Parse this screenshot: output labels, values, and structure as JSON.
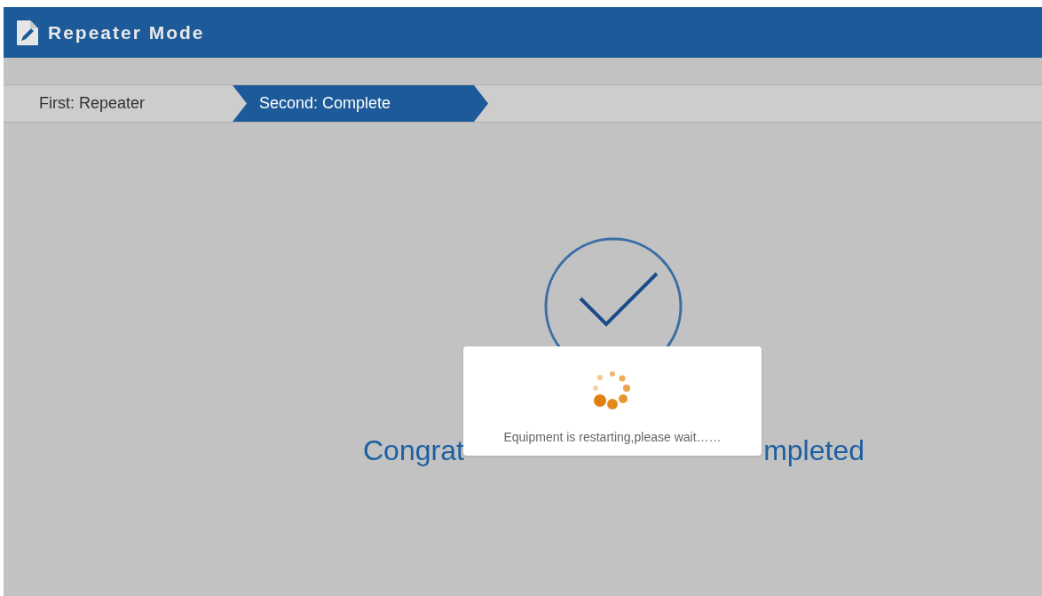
{
  "header": {
    "title": "Repeater Mode"
  },
  "steps": [
    {
      "label": "First: Repeater",
      "selected": false
    },
    {
      "label": "Second: Complete",
      "selected": true
    }
  ],
  "result": {
    "message_start": "Congrat",
    "message_end": "mpleted"
  },
  "dialog": {
    "message": "Equipment is restarting,please wait……"
  }
}
